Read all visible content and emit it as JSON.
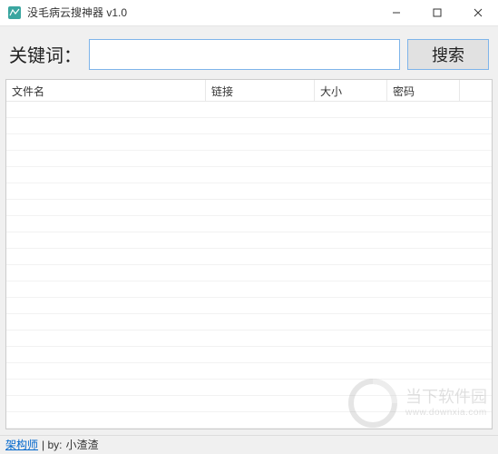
{
  "titlebar": {
    "title": "没毛病云搜神器 v1.0"
  },
  "search": {
    "label": "关键词：",
    "input_value": "",
    "placeholder": "",
    "button_label": "搜索"
  },
  "list": {
    "columns": {
      "filename": "文件名",
      "link": "链接",
      "size": "大小",
      "password": "密码"
    }
  },
  "statusbar": {
    "link_label": "架构师",
    "separator": " | by:",
    "author": "小渣渣"
  },
  "watermark": {
    "brand_cn": "当下软件园",
    "brand_en": "www.downxia.com"
  }
}
